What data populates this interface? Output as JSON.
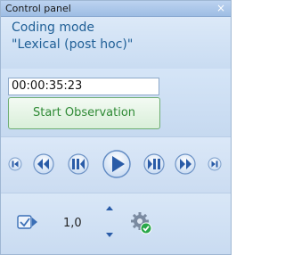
{
  "window": {
    "title": "Control panel",
    "close_glyph": "×"
  },
  "mode": {
    "line1": "Coding mode",
    "line2": "\"Lexical (post hoc)\""
  },
  "observation": {
    "timer_value": "00:00:35:23",
    "start_label": "Start Observation"
  },
  "transport": {
    "icons": [
      "skip-to-start-icon",
      "fast-rewind-icon",
      "step-back-icon",
      "play-icon",
      "step-forward-icon",
      "fast-forward-icon",
      "skip-to-end-icon"
    ]
  },
  "speed": {
    "value": "1,0"
  },
  "colors": {
    "accent_blue": "#1f5f96",
    "start_green": "#2f8a35",
    "check_green": "#2aa84a"
  }
}
